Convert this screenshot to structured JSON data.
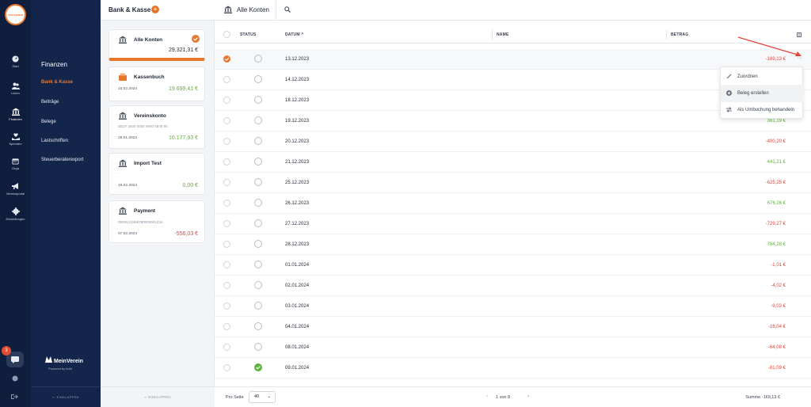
{
  "logo": {
    "text": "TESTVEREIN"
  },
  "rail": [
    {
      "label": "Start",
      "icon": "dashboard-icon"
    },
    {
      "label": "Listen",
      "icon": "people-icon"
    },
    {
      "label": "Finanzen",
      "icon": "bank-icon"
    },
    {
      "label": "Spenden",
      "icon": "heart-hand-icon"
    },
    {
      "label": "Orga",
      "icon": "calendar-icon"
    },
    {
      "label": "Vereinsportal",
      "icon": "megaphone-icon"
    },
    {
      "label": "Einstellungen",
      "icon": "gear-icon"
    }
  ],
  "notifications": {
    "count": "3"
  },
  "subnav": {
    "title": "Finanzen",
    "items": [
      "Bank & Kasse",
      "Beiträge",
      "Belege",
      "Lastschriften",
      "Steuerberaterexport"
    ],
    "active": "Bank & Kasse",
    "brand_name": "MeinVerein",
    "brand_sub": "Powered by  buhl",
    "collapse": "EINKLAPPEN"
  },
  "accounts": {
    "title": "Bank & Kasse",
    "add": "+",
    "collapse": "EINKLAPPEN",
    "cards": [
      {
        "name": "Alle Konten",
        "iban": "",
        "date": "",
        "amount": "29.321,31 €",
        "sign": "neutral"
      },
      {
        "name": "Kassenbuch",
        "iban": "",
        "date": "15.02.2024",
        "amount": "19.699,41 €",
        "sign": "pos"
      },
      {
        "name": "Vereinskonto",
        "iban": "DE37 3400 0000 0000 5678 90",
        "date": "25.01.2024",
        "amount": "10.177,93 €",
        "sign": "pos"
      },
      {
        "name": "Import Test",
        "iban": "-",
        "date": "19.02.2024",
        "amount": "0,00 €",
        "sign": "pos"
      },
      {
        "name": "Payment",
        "iban": "DE00123456780000001234",
        "date": "07.02.2024",
        "amount": "-556,03 €",
        "sign": "neg"
      }
    ]
  },
  "main": {
    "title": "Alle Konten",
    "columns": {
      "status": "STATUS",
      "date": "DATUM",
      "name": "NAME",
      "amount": "BETRAG"
    },
    "rows": [
      {
        "date": "13.12.2023",
        "amount": "-169,13 €",
        "sign": "neg",
        "checked": true,
        "status": "open"
      },
      {
        "date": "14.12.2023",
        "amount": "",
        "sign": "neg",
        "checked": false,
        "status": "open"
      },
      {
        "date": "18.12.2023",
        "amount": "",
        "sign": "neg",
        "checked": false,
        "status": "open"
      },
      {
        "date": "19.12.2023",
        "amount": "361,19 €",
        "sign": "pos",
        "checked": false,
        "status": "open"
      },
      {
        "date": "20.12.2023",
        "amount": "-400,20 €",
        "sign": "neg",
        "checked": false,
        "status": "open"
      },
      {
        "date": "21.12.2023",
        "amount": "441,21 €",
        "sign": "pos",
        "checked": false,
        "status": "open"
      },
      {
        "date": "25.12.2023",
        "amount": "-625,25 €",
        "sign": "neg",
        "checked": false,
        "status": "open"
      },
      {
        "date": "26.12.2023",
        "amount": "676,26 €",
        "sign": "pos",
        "checked": false,
        "status": "open"
      },
      {
        "date": "27.12.2023",
        "amount": "-729,27 €",
        "sign": "neg",
        "checked": false,
        "status": "open"
      },
      {
        "date": "28.12.2023",
        "amount": "784,28 €",
        "sign": "pos",
        "checked": false,
        "status": "open"
      },
      {
        "date": "01.01.2024",
        "amount": "-1,01 €",
        "sign": "neg",
        "checked": false,
        "status": "open"
      },
      {
        "date": "02.01.2024",
        "amount": "-4,02 €",
        "sign": "neg",
        "checked": false,
        "status": "open"
      },
      {
        "date": "03.01.2024",
        "amount": "-9,03 €",
        "sign": "neg",
        "checked": false,
        "status": "open"
      },
      {
        "date": "04.01.2024",
        "amount": "-16,04 €",
        "sign": "neg",
        "checked": false,
        "status": "open"
      },
      {
        "date": "08.01.2024",
        "amount": "-64,08 €",
        "sign": "neg",
        "checked": false,
        "status": "open"
      },
      {
        "date": "09.01.2024",
        "amount": "-81,09 €",
        "sign": "neg",
        "checked": false,
        "status": "done"
      }
    ],
    "context_menu": [
      "Zuordnen",
      "Beleg erstellen",
      "Als Umbuchung behandeln"
    ],
    "footer": {
      "per_page_label": "Pro Seite",
      "per_page": "40",
      "pagination": "1 von 8",
      "sum": "Summe  -169,13 €"
    }
  },
  "colors": {
    "accent": "#e8772e",
    "positive": "#62b236",
    "negative": "#e2453c",
    "sidebar": "#0f1e3d"
  }
}
